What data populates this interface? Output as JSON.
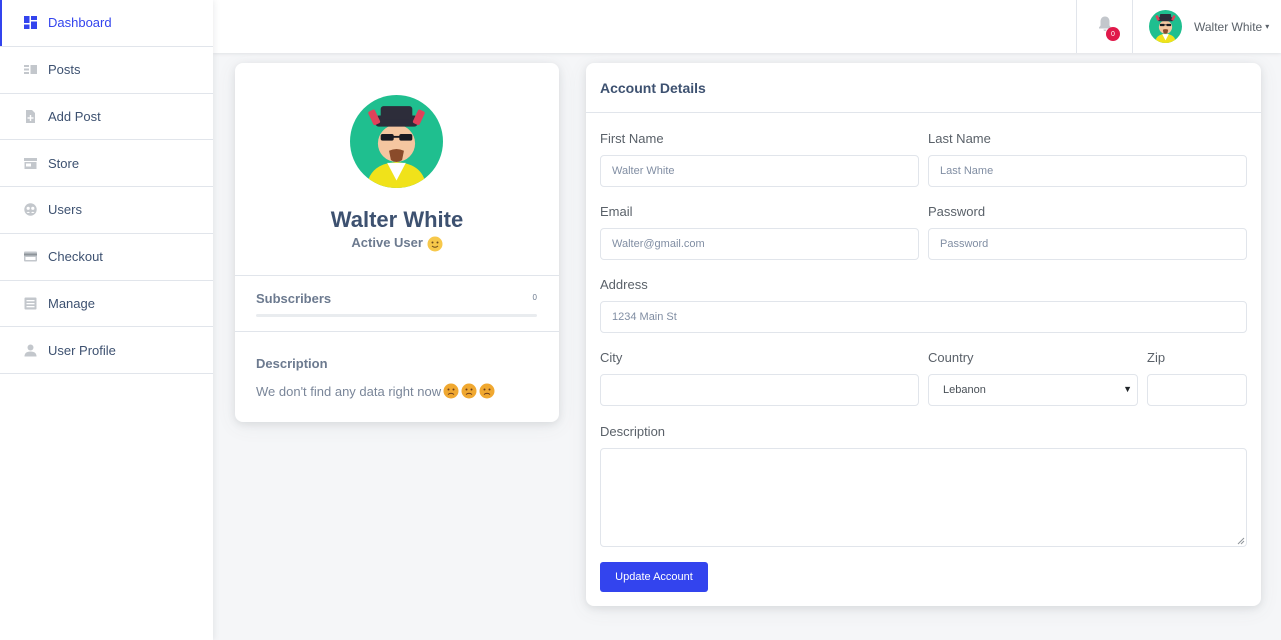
{
  "sidebar": {
    "items": [
      {
        "label": "Dashboard",
        "icon": "dashboard-icon"
      },
      {
        "label": "Posts",
        "icon": "posts-icon"
      },
      {
        "label": "Add Post",
        "icon": "add-post-icon"
      },
      {
        "label": "Store",
        "icon": "store-icon"
      },
      {
        "label": "Users",
        "icon": "users-icon"
      },
      {
        "label": "Checkout",
        "icon": "checkout-icon"
      },
      {
        "label": "Manage",
        "icon": "manage-icon"
      },
      {
        "label": "User Profile",
        "icon": "user-profile-icon"
      }
    ],
    "active_color": "#3344ee"
  },
  "topbar": {
    "notification_count": "0",
    "user_name": "Walter White",
    "caret": "▾"
  },
  "profile": {
    "name": "Walter White",
    "status": "Active User",
    "subscribers_label": "Subscribers",
    "subscribers_count": "0",
    "subscribers_progress": 0,
    "description_label": "Description",
    "description_text": "We don't find any data right now"
  },
  "account": {
    "title": "Account Details",
    "first_name": {
      "label": "First Name",
      "placeholder": "Walter White"
    },
    "last_name": {
      "label": "Last Name",
      "placeholder": "Last Name"
    },
    "email": {
      "label": "Email",
      "placeholder": "Walter@gmail.com"
    },
    "password": {
      "label": "Password",
      "placeholder": "Password"
    },
    "address": {
      "label": "Address",
      "placeholder": "1234 Main St"
    },
    "city": {
      "label": "City",
      "placeholder": ""
    },
    "country": {
      "label": "Country",
      "value": "Lebanon",
      "arrow": "▼"
    },
    "zip": {
      "label": "Zip",
      "placeholder": ""
    },
    "description": {
      "label": "Description"
    },
    "submit_label": "Update Account"
  },
  "colors": {
    "accent": "#3344ee",
    "badge": "#e0194a",
    "background": "#f5f6f8"
  }
}
